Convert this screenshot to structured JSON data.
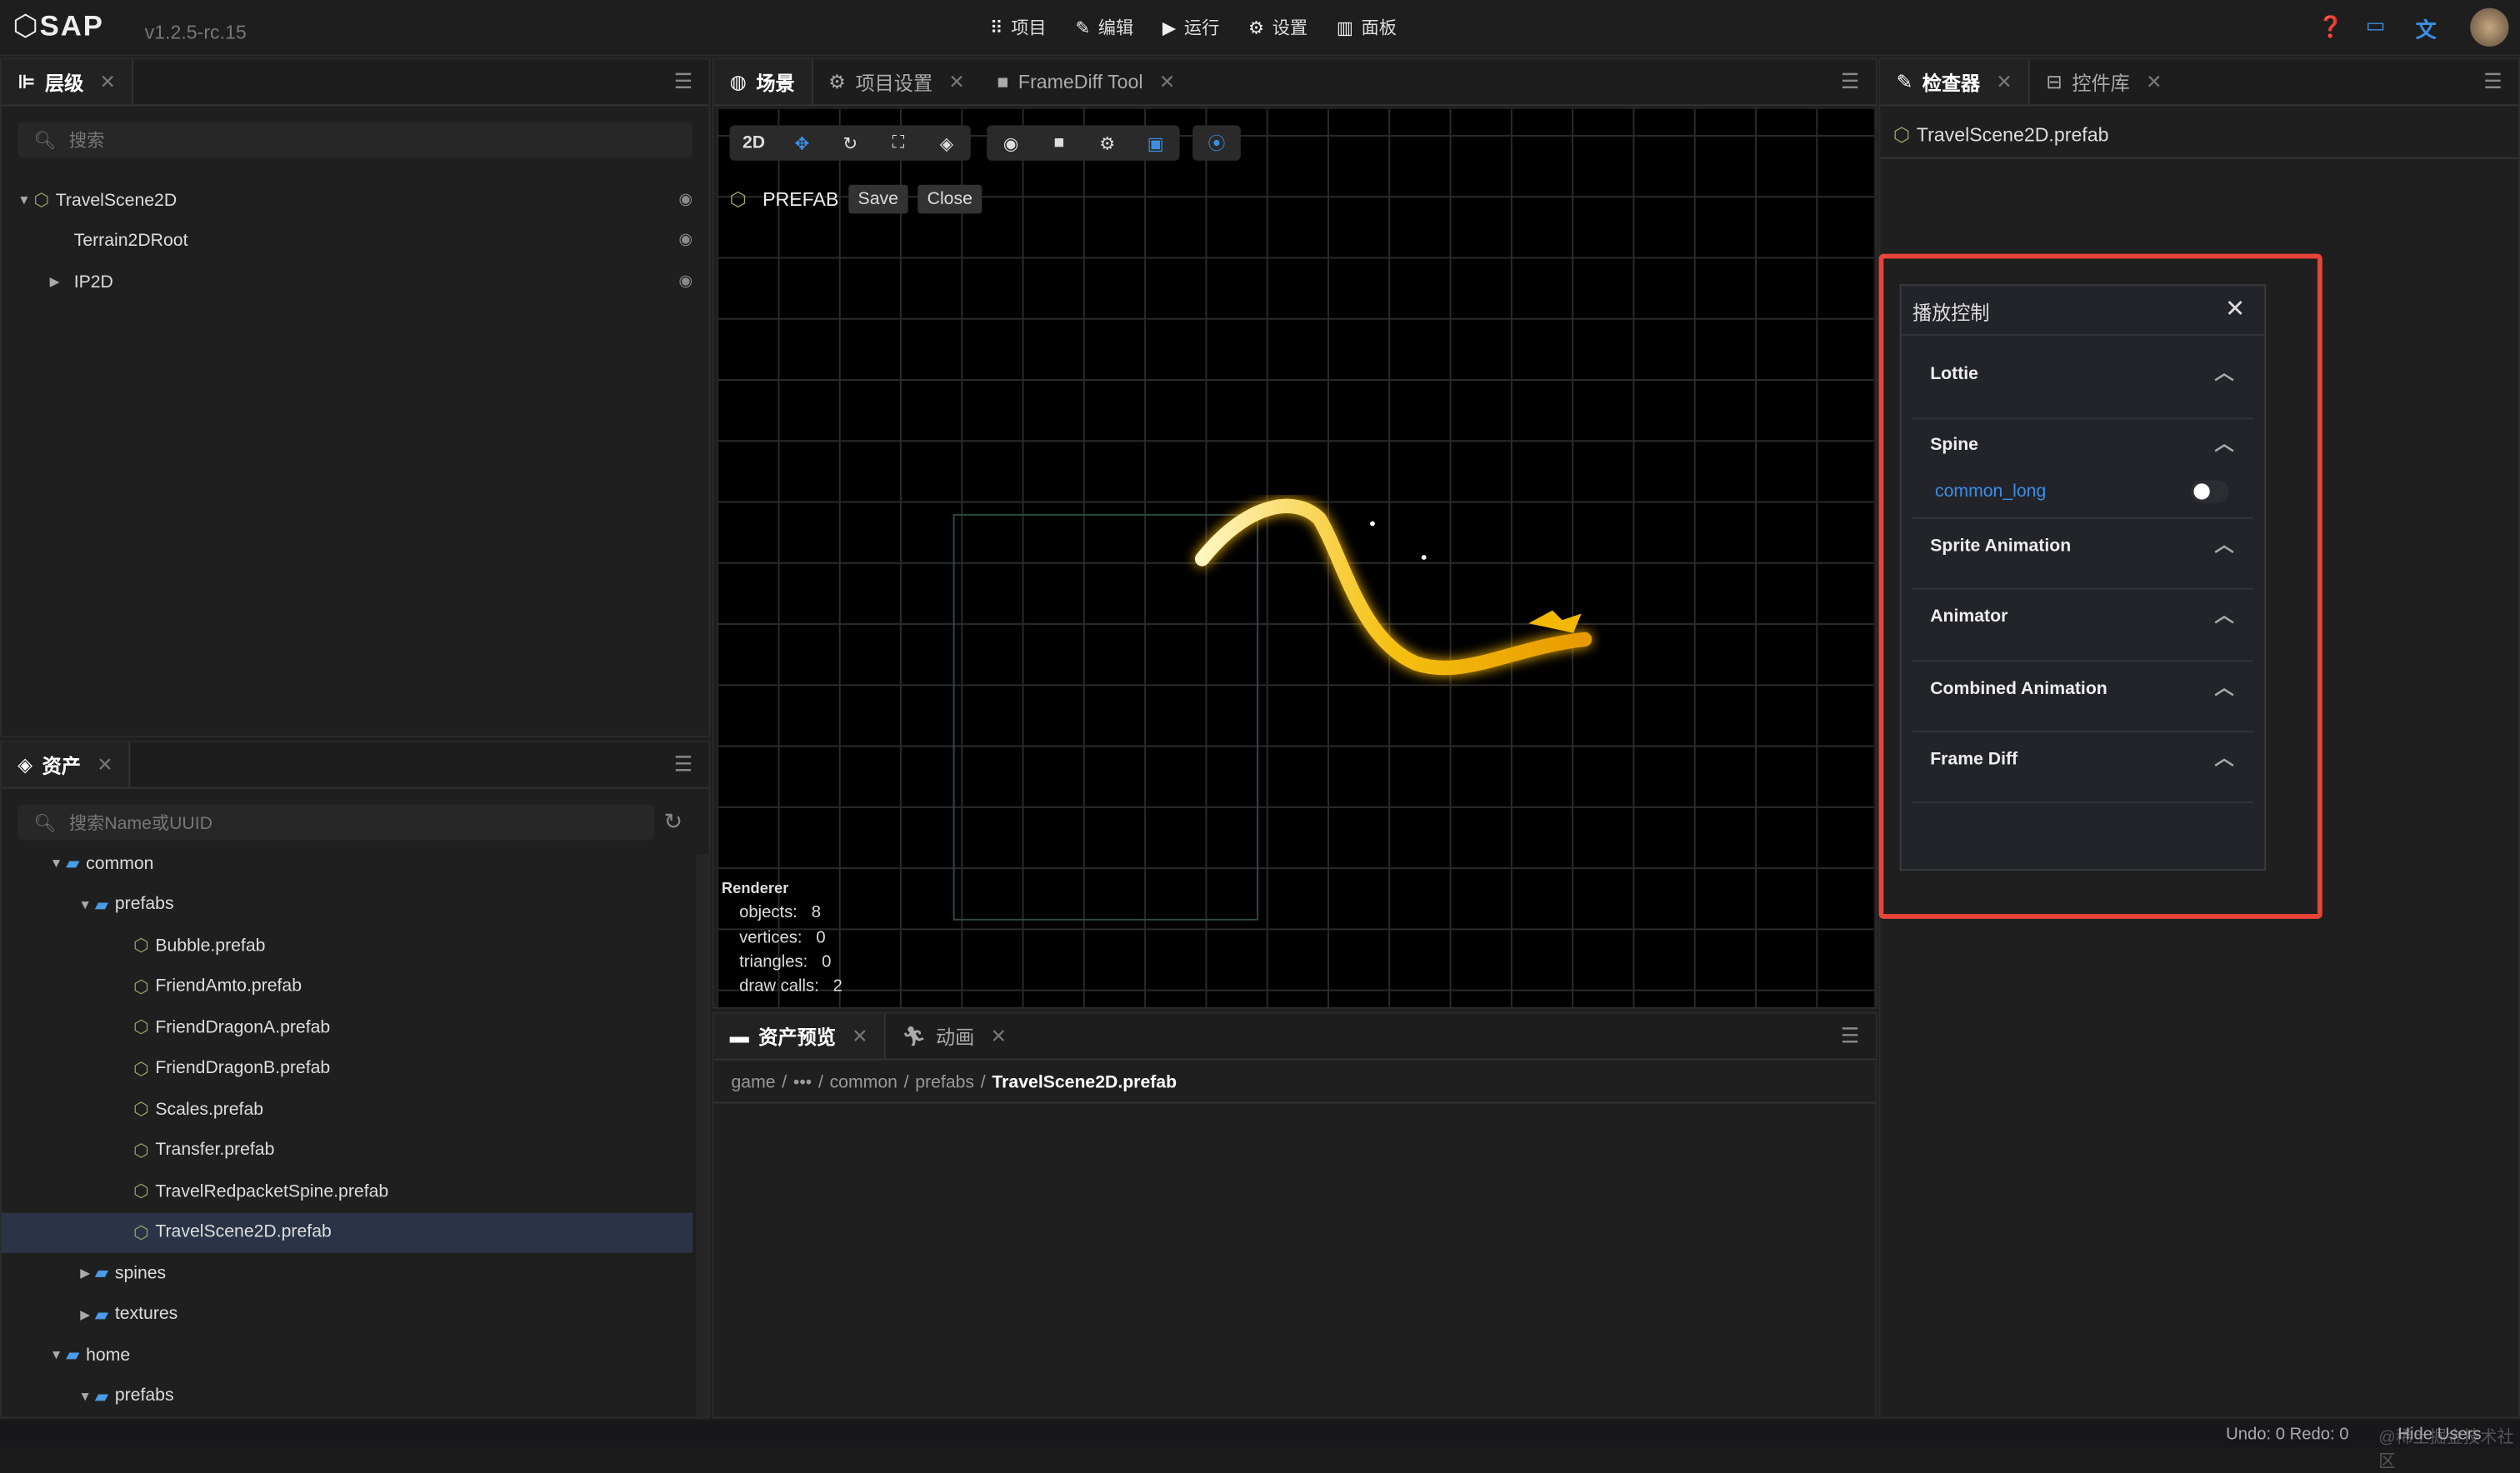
{
  "app": {
    "logo": "SAP",
    "version": "v1.2.5-rc.15"
  },
  "menu": [
    {
      "icon": "grid-icon",
      "label": "项目"
    },
    {
      "icon": "pencil-icon",
      "label": "编辑"
    },
    {
      "icon": "play-icon",
      "label": "运行"
    },
    {
      "icon": "gear-icon",
      "label": "设置"
    },
    {
      "icon": "panel-icon",
      "label": "面板"
    }
  ],
  "hierarchy": {
    "tab": "层级",
    "search_placeholder": "搜索",
    "nodes": [
      {
        "label": "TravelScene2D",
        "expanded": true
      },
      {
        "label": "Terrain2DRoot"
      },
      {
        "label": "IP2D",
        "expanded": false
      }
    ]
  },
  "assets": {
    "tab": "资产",
    "search_placeholder": "搜索Name或UUID",
    "items": [
      {
        "label": "common",
        "type": "folder",
        "depth": 1,
        "expanded": true
      },
      {
        "label": "prefabs",
        "type": "folder",
        "depth": 2,
        "expanded": true
      },
      {
        "label": "Bubble.prefab",
        "type": "prefab",
        "depth": 3
      },
      {
        "label": "FriendAmto.prefab",
        "type": "prefab",
        "depth": 3
      },
      {
        "label": "FriendDragonA.prefab",
        "type": "prefab",
        "depth": 3
      },
      {
        "label": "FriendDragonB.prefab",
        "type": "prefab",
        "depth": 3
      },
      {
        "label": "Scales.prefab",
        "type": "prefab",
        "depth": 3
      },
      {
        "label": "Transfer.prefab",
        "type": "prefab",
        "depth": 3
      },
      {
        "label": "TravelRedpacketSpine.prefab",
        "type": "prefab",
        "depth": 3
      },
      {
        "label": "TravelScene2D.prefab",
        "type": "prefab",
        "depth": 3,
        "selected": true
      },
      {
        "label": "spines",
        "type": "folder",
        "depth": 2,
        "expanded": false
      },
      {
        "label": "textures",
        "type": "folder",
        "depth": 2,
        "expanded": false
      },
      {
        "label": "home",
        "type": "folder",
        "depth": 1,
        "expanded": true
      },
      {
        "label": "prefabs",
        "type": "folder",
        "depth": 2,
        "expanded": true
      }
    ]
  },
  "center_tabs": [
    {
      "label": "场景",
      "active": true
    },
    {
      "label": "项目设置"
    },
    {
      "label": "FrameDiff Tool"
    }
  ],
  "scene": {
    "toolbar_2d": "2D",
    "prefab_label": "PREFAB",
    "save": "Save",
    "close": "Close",
    "renderer": {
      "title": "Renderer",
      "objects": "objects:   8",
      "vertices": "vertices:   0",
      "triangles": "triangles:   0",
      "draw_calls": "draw calls:   2"
    }
  },
  "bottom_tabs": [
    {
      "label": "资产预览",
      "active": true
    },
    {
      "label": "动画"
    }
  ],
  "breadcrumb": {
    "parts": [
      "game",
      "•••",
      "common",
      "prefabs"
    ],
    "current": "TravelScene2D.prefab"
  },
  "right_tabs": [
    {
      "label": "检查器",
      "active": true
    },
    {
      "label": "控件库"
    }
  ],
  "inspector": {
    "title": "TravelScene2D.prefab"
  },
  "playback": {
    "title": "播放控制",
    "sections": [
      {
        "label": "Lottie"
      },
      {
        "label": "Spine",
        "items": [
          {
            "label": "common_long",
            "toggle": false
          }
        ]
      },
      {
        "label": "Sprite Animation"
      },
      {
        "label": "Animator"
      },
      {
        "label": "Combined Animation"
      },
      {
        "label": "Frame Diff"
      }
    ]
  },
  "status": {
    "undo_redo": "Undo: 0 Redo: 0",
    "hide_users": "Hide Users",
    "watermark": "@稀土掘金技术社区"
  },
  "colors": {
    "accent": "#3b8fe6",
    "highlight": "#e8443a",
    "selected_row": "#2a3446"
  }
}
